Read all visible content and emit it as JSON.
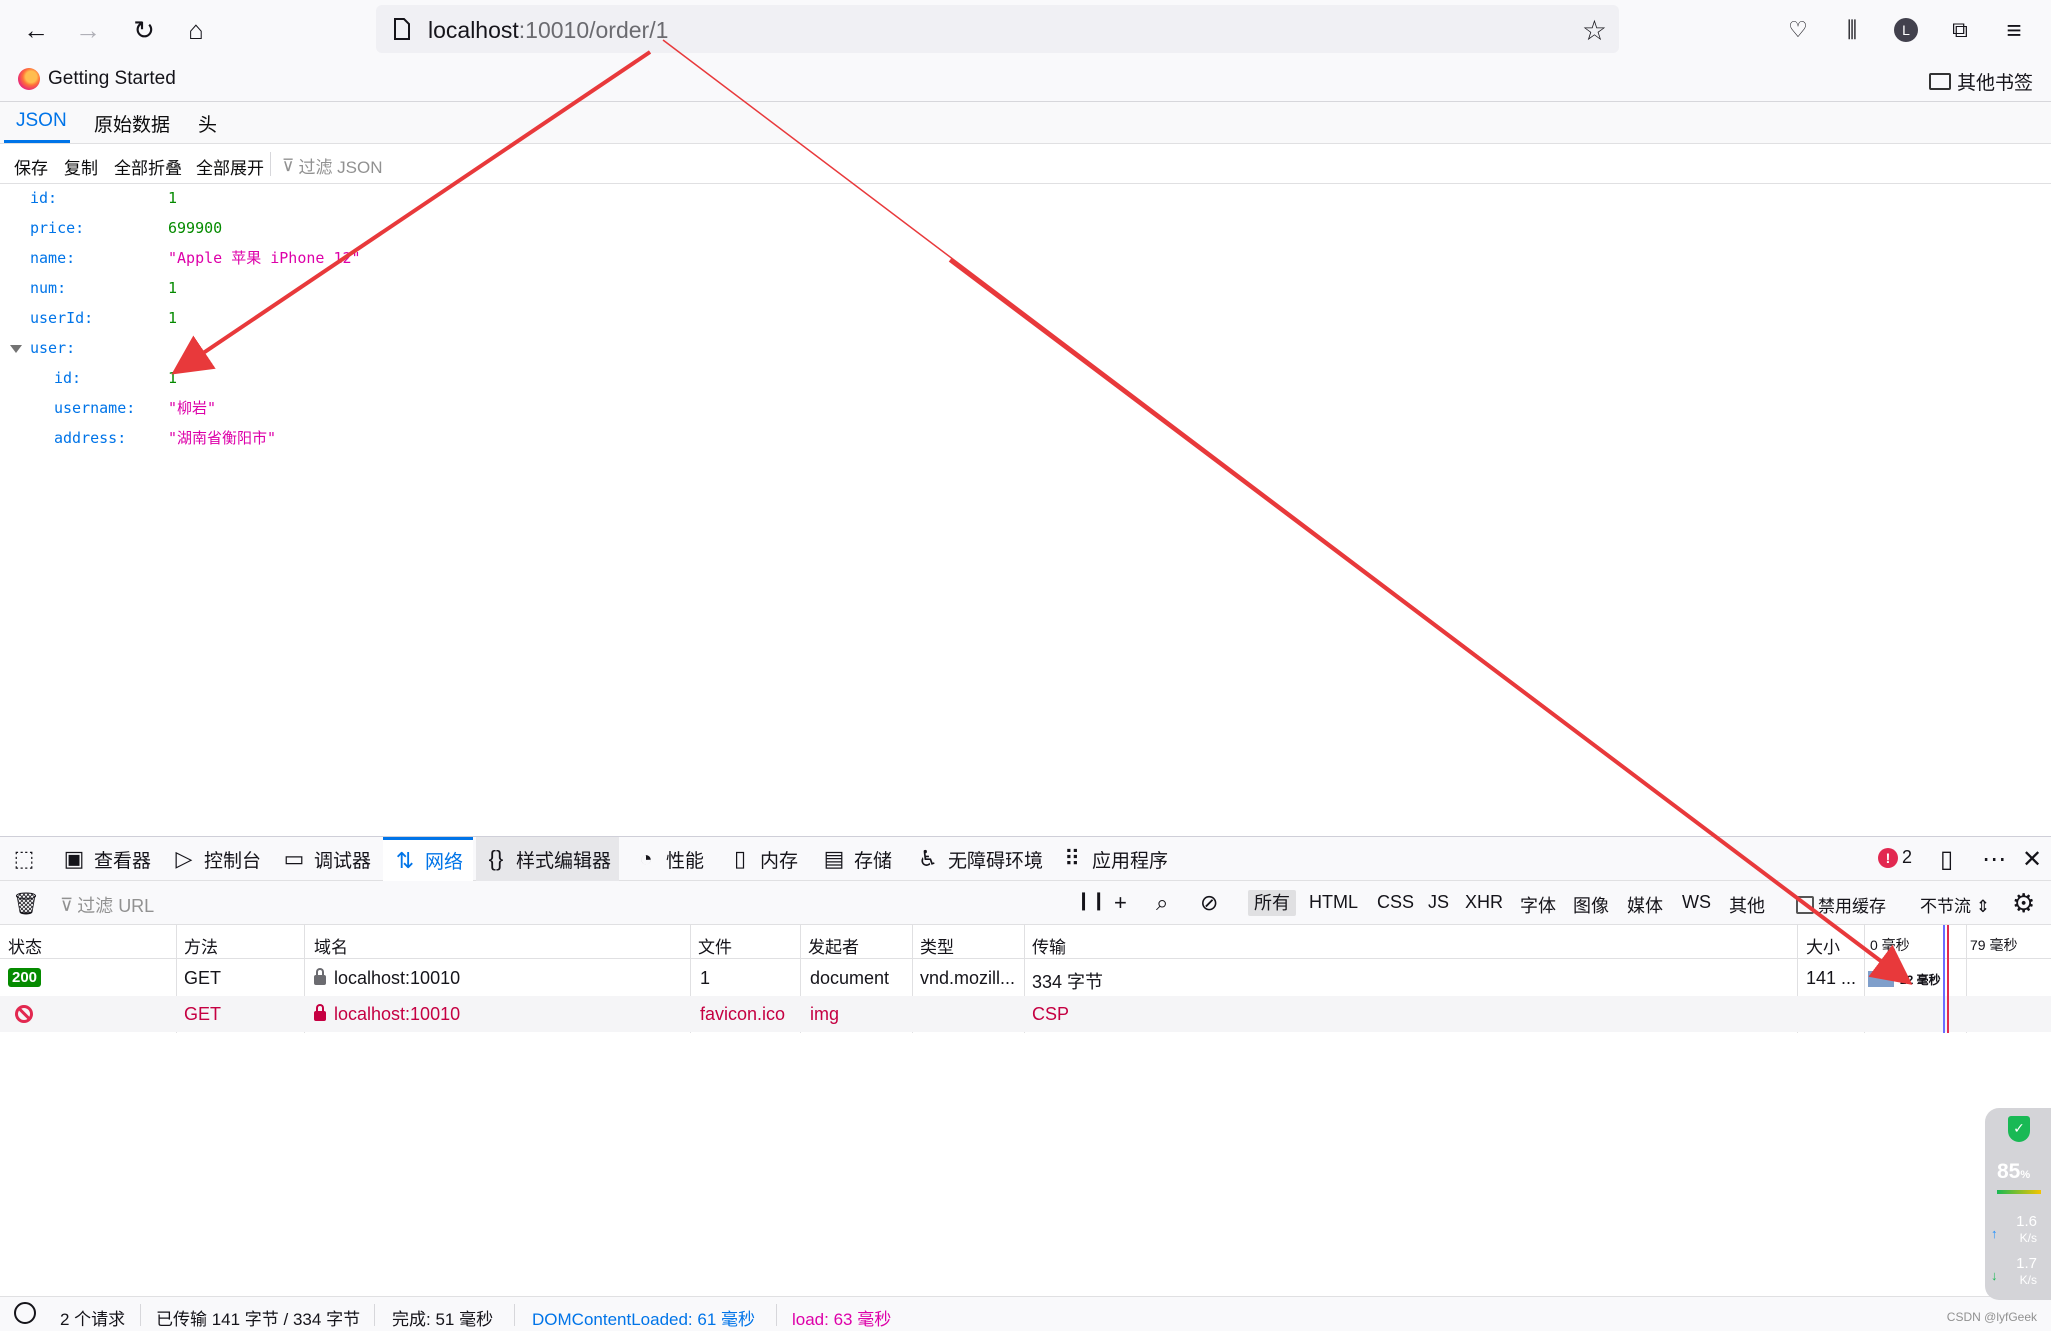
{
  "browser": {
    "url_host": "localhost",
    "url_path": ":10010/order/1",
    "bookmarks": {
      "getting_started": "Getting Started",
      "other": "其他书签"
    },
    "profile_initial": "L"
  },
  "json_viewer": {
    "tabs": [
      {
        "label": "JSON"
      },
      {
        "label": "原始数据"
      },
      {
        "label": "头"
      }
    ],
    "actions": {
      "save": "保存",
      "copy": "复制",
      "collapse_all": "全部折叠",
      "expand_all": "全部展开",
      "filter_placeholder": "过滤 JSON"
    },
    "rows": [
      {
        "key": "id:",
        "value": "1"
      },
      {
        "key": "price:",
        "value": "699900"
      },
      {
        "key": "name:",
        "value": "\"Apple 苹果 iPhone 12\""
      },
      {
        "key": "num:",
        "value": "1"
      },
      {
        "key": "userId:",
        "value": "1"
      },
      {
        "key": "user:",
        "value": ""
      },
      {
        "key": "id:",
        "value": "1"
      },
      {
        "key": "username:",
        "value": "\"柳岩\""
      },
      {
        "key": "address:",
        "value": "\"湖南省衡阳市\""
      }
    ]
  },
  "devtools": {
    "tabs": [
      {
        "label": "查看器"
      },
      {
        "label": "控制台"
      },
      {
        "label": "调试器"
      },
      {
        "label": "网络"
      },
      {
        "label": "样式编辑器"
      },
      {
        "label": "性能"
      },
      {
        "label": "内存"
      },
      {
        "label": "存储"
      },
      {
        "label": "无障碍环境"
      },
      {
        "label": "应用程序"
      }
    ],
    "error_count": "2",
    "url_filter_placeholder": "过滤 URL",
    "type_filters": [
      "所有",
      "HTML",
      "CSS",
      "JS",
      "XHR",
      "字体",
      "图像",
      "媒体",
      "WS",
      "其他"
    ],
    "disable_cache": "禁用缓存",
    "throttling": "不节流 ⇕",
    "columns": [
      "状态",
      "方法",
      "域名",
      "文件",
      "发起者",
      "类型",
      "传输",
      "大小",
      "0 毫秒",
      "79 毫秒"
    ],
    "requests": [
      {
        "status": "200",
        "method": "GET",
        "domain": "localhost:10010",
        "file": "1",
        "initiator": "document",
        "type": "vnd.mozill...",
        "transferred": "334 字节",
        "size": "141 ...",
        "timing": "22 毫秒"
      },
      {
        "status": "",
        "method": "GET",
        "domain": "localhost:10010",
        "file": "favicon.ico",
        "initiator": "img",
        "type": "",
        "transferred": "CSP",
        "size": "",
        "timing": ""
      }
    ],
    "statusbar": {
      "requests": "2 个请求",
      "transferred": "已传输 141 字节 / 334 字节",
      "finish": "完成: 51 毫秒",
      "dom_loaded": "DOMContentLoaded: 61 毫秒",
      "load": "load: 63 毫秒"
    }
  },
  "widget": {
    "percent": "85",
    "percent_unit": "%",
    "up_rate": "1.6",
    "down_rate": "1.7",
    "rate_unit": "K/s"
  },
  "watermark": "CSDN @lyfGeek",
  "colors": {
    "accent": "#0074e8",
    "number": "#058b00",
    "string": "#dd00a9",
    "error": "#c50042",
    "annotation_arrow": "#e8393b"
  }
}
